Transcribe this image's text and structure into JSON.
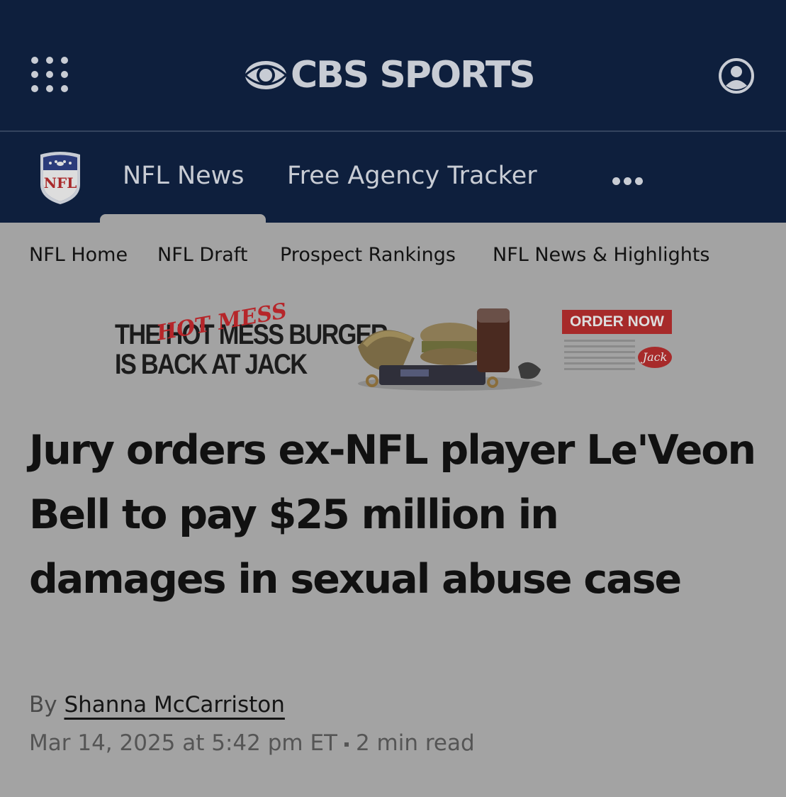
{
  "header": {
    "brand": "CBS SPORTS",
    "menu_icon": "grid-menu-icon",
    "account_icon": "user-account-icon"
  },
  "subnav": {
    "logo": "NFL",
    "items": [
      {
        "label": "NFL News",
        "active": true
      },
      {
        "label": "Free Agency Tracker",
        "active": false
      }
    ],
    "more_icon": "more-horizontal-icon"
  },
  "secondary_nav": {
    "items": [
      {
        "label": "NFL Home"
      },
      {
        "label": "NFL Draft"
      },
      {
        "label": "Prospect Rankings"
      },
      {
        "label": "NFL News & Highlights"
      }
    ]
  },
  "ad": {
    "headline_line1": "THE HOT MESS BURGER",
    "headline_line2": "IS BACK AT JACK",
    "script_text": "HOT MESS",
    "cta": "ORDER NOW",
    "logo_text": "Jack"
  },
  "article": {
    "headline": "Jury orders ex-NFL player Le'Veon Bell to pay $25 million in damages in sexual abuse case",
    "by_prefix": "By",
    "author": "Shanna McCarriston",
    "date": "Mar 14, 2025 at 5:42 pm ET",
    "read_time": "2 min read"
  },
  "colors": {
    "header_bg": "#0e1f3d",
    "page_bg": "#a3a3a3",
    "text_light": "#c8ccd4",
    "text_dark": "#111111",
    "ad_red": "#a72a2a"
  }
}
